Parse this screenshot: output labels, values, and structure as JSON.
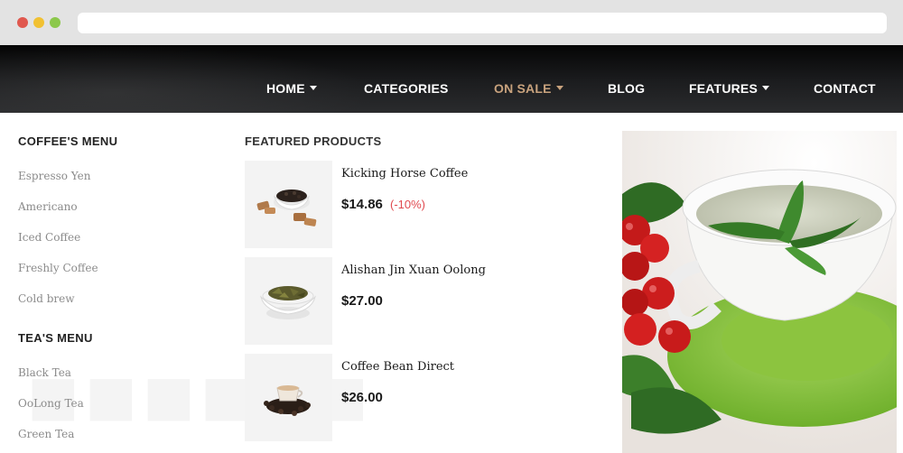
{
  "nav": {
    "items": [
      {
        "label": "HOME"
      },
      {
        "label": "CATEGORIES"
      },
      {
        "label": "ON SALE"
      },
      {
        "label": "BLOG"
      },
      {
        "label": "FEATURES"
      },
      {
        "label": "CONTACT"
      }
    ],
    "active_color": "#c8a27d"
  },
  "coffee_menu": {
    "heading": "COFFEE'S MENU",
    "items": [
      "Espresso Yen",
      "Americano",
      "Iced Coffee",
      "Freshly Coffee",
      "Cold brew"
    ]
  },
  "tea_menu": {
    "heading": "TEA'S MENU",
    "items": [
      "Black Tea",
      "OoLong Tea",
      "Green Tea"
    ]
  },
  "featured": {
    "heading": "FEATURED PRODUCTS",
    "products": [
      {
        "name": "Kicking Horse Coffee",
        "price": "$14.86",
        "discount": "(-10%)"
      },
      {
        "name": "Alishan Jin Xuan Oolong",
        "price": "$27.00"
      },
      {
        "name": "Coffee Bean Direct",
        "price": "$26.00"
      }
    ]
  },
  "colors": {
    "discount": "#e0494f",
    "heading": "#222222",
    "menu_link": "#8b8b8b"
  }
}
